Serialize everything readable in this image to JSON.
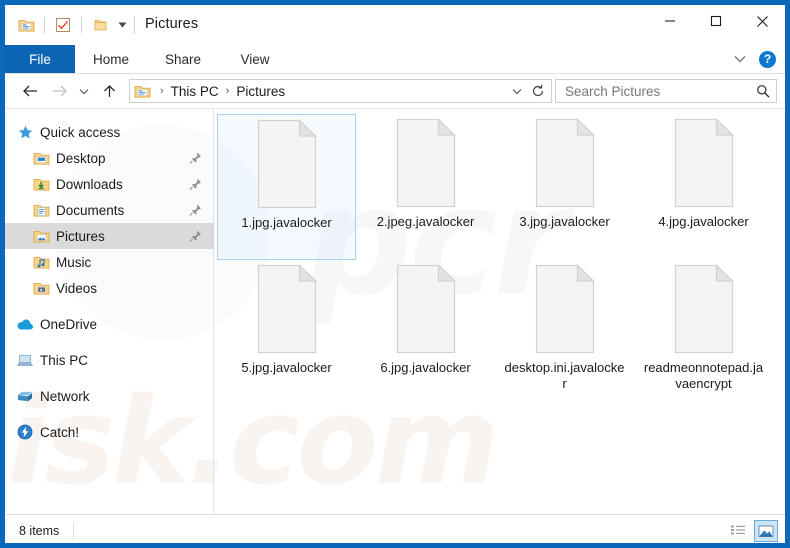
{
  "window": {
    "title": "Pictures",
    "controls": {
      "minimize": "minimize-icon",
      "maximize": "maximize-icon",
      "close": "close-icon"
    },
    "quick_access_toolbar": [
      {
        "name": "properties-icon"
      },
      {
        "name": "checkbox-icon"
      },
      {
        "name": "new-folder-icon"
      },
      {
        "name": "customize-dropdown-icon"
      }
    ]
  },
  "ribbon": {
    "tabs": [
      {
        "label": "File",
        "active": true
      },
      {
        "label": "Home",
        "active": false
      },
      {
        "label": "Share",
        "active": false
      },
      {
        "label": "View",
        "active": false
      }
    ],
    "expand_label": "chevron-down-icon",
    "help_label": "?"
  },
  "addressbar": {
    "back": "back-arrow-icon",
    "forward": "forward-arrow-icon",
    "recent": "recent-locations-icon",
    "up": "up-arrow-icon",
    "breadcrumb": [
      "This PC",
      "Pictures"
    ],
    "separator": "›",
    "dropdown": "chevron-down-icon",
    "refresh": "refresh-icon"
  },
  "search": {
    "placeholder": "Search Pictures",
    "value": "",
    "icon": "search-icon"
  },
  "sidebar": {
    "items": [
      {
        "label": "Quick access",
        "icon": "star-icon",
        "indent": 0,
        "pinned": false,
        "selected": false
      },
      {
        "label": "Desktop",
        "icon": "desktop-folder-icon",
        "indent": 1,
        "pinned": true,
        "selected": false
      },
      {
        "label": "Downloads",
        "icon": "downloads-folder-icon",
        "indent": 1,
        "pinned": true,
        "selected": false
      },
      {
        "label": "Documents",
        "icon": "documents-folder-icon",
        "indent": 1,
        "pinned": true,
        "selected": false
      },
      {
        "label": "Pictures",
        "icon": "pictures-folder-icon",
        "indent": 1,
        "pinned": true,
        "selected": true
      },
      {
        "label": "Music",
        "icon": "music-folder-icon",
        "indent": 1,
        "pinned": false,
        "selected": false
      },
      {
        "label": "Videos",
        "icon": "videos-folder-icon",
        "indent": 1,
        "pinned": false,
        "selected": false
      },
      {
        "label": "OneDrive",
        "icon": "onedrive-cloud-icon",
        "indent": 0,
        "pinned": false,
        "selected": false,
        "gap_before": true
      },
      {
        "label": "This PC",
        "icon": "this-pc-icon",
        "indent": 0,
        "pinned": false,
        "selected": false,
        "gap_before": true
      },
      {
        "label": "Network",
        "icon": "network-icon",
        "indent": 0,
        "pinned": false,
        "selected": false,
        "gap_before": true
      },
      {
        "label": "Catch!",
        "icon": "catch-lightning-icon",
        "indent": 0,
        "pinned": false,
        "selected": false,
        "gap_before": true
      }
    ]
  },
  "files": [
    {
      "name": "1.jpg.javalocker",
      "icon": "generic-file-icon",
      "selected": true
    },
    {
      "name": "2.jpeg.javalocker",
      "icon": "generic-file-icon",
      "selected": false
    },
    {
      "name": "3.jpg.javalocker",
      "icon": "generic-file-icon",
      "selected": false
    },
    {
      "name": "4.jpg.javalocker",
      "icon": "generic-file-icon",
      "selected": false
    },
    {
      "name": "5.jpg.javalocker",
      "icon": "generic-file-icon",
      "selected": false
    },
    {
      "name": "6.jpg.javalocker",
      "icon": "generic-file-icon",
      "selected": false
    },
    {
      "name": "desktop.ini.javalocker",
      "icon": "generic-file-icon",
      "selected": false
    },
    {
      "name": "readmeonnotepad.javaencrypt",
      "icon": "generic-file-icon",
      "selected": false
    }
  ],
  "statusbar": {
    "count": "8 items",
    "views": [
      {
        "name": "details-view-button",
        "active": false
      },
      {
        "name": "large-icons-view-button",
        "active": true
      }
    ]
  },
  "watermark": {
    "left_text": "isk.com",
    "right_text": "pcr"
  },
  "colors": {
    "window_border": "#0a69bb",
    "file_tab": "#0c64b4",
    "selection_border": "#a8d2f0",
    "help_blue": "#0c78d2"
  }
}
